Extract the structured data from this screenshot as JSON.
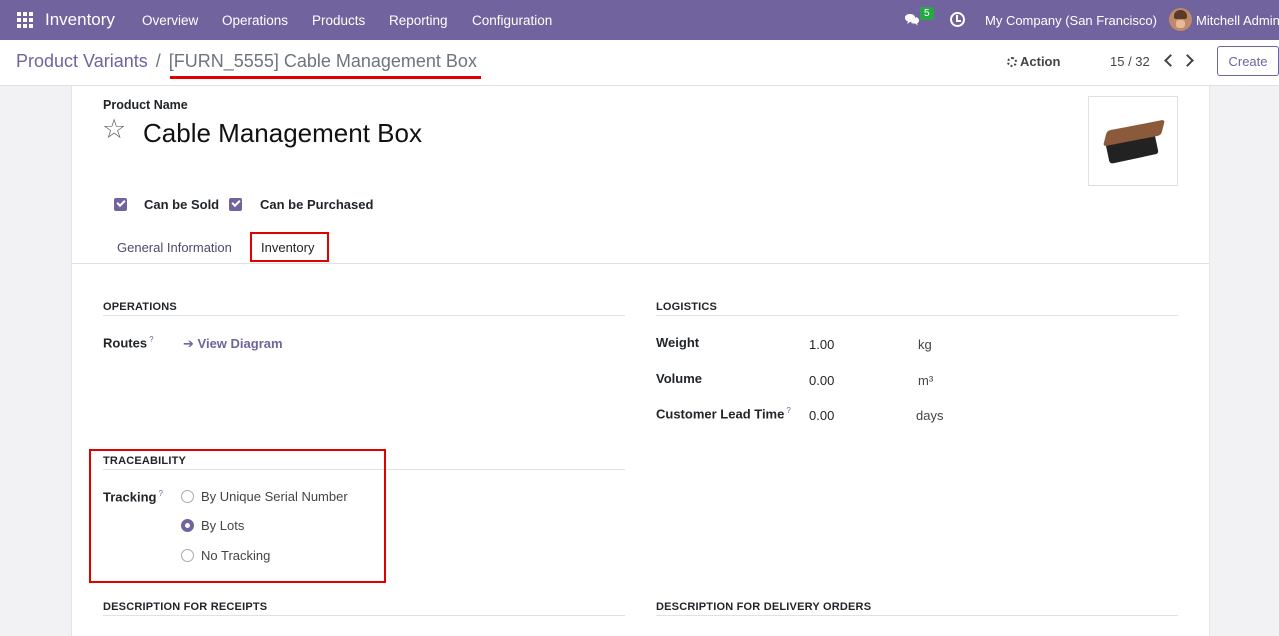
{
  "navbar": {
    "app_title": "Inventory",
    "menu": [
      "Overview",
      "Operations",
      "Products",
      "Reporting",
      "Configuration"
    ],
    "chat_badge": "5",
    "company": "My Company (San Francisco)",
    "user": "Mitchell Admin"
  },
  "control": {
    "breadcrumb_parent": "Product Variants",
    "breadcrumb_sep": "/",
    "breadcrumb_current": "[FURN_5555] Cable Management Box",
    "action_label": "Action",
    "pager": "15 / 32",
    "create_label": "Create"
  },
  "form": {
    "product_name_label": "Product Name",
    "product_name": "Cable Management Box",
    "can_be_sold": "Can be Sold",
    "can_be_purchased": "Can be Purchased",
    "tabs": [
      "General Information",
      "Inventory"
    ],
    "operations": {
      "title": "OPERATIONS",
      "routes_label": "Routes",
      "help_mark": "?",
      "view_diagram": "View Diagram"
    },
    "logistics": {
      "title": "LOGISTICS",
      "weight_label": "Weight",
      "weight_value": "1.00",
      "weight_unit": "kg",
      "volume_label": "Volume",
      "volume_value": "0.00",
      "volume_unit": "m³",
      "lead_time_label": "Customer Lead Time",
      "lead_time_value": "0.00",
      "lead_time_unit": "days"
    },
    "traceability": {
      "title": "TRACEABILITY",
      "tracking_label": "Tracking",
      "options": [
        "By Unique Serial Number",
        "By Lots",
        "No Tracking"
      ],
      "selected": "By Lots"
    },
    "desc_receipts": "DESCRIPTION FOR RECEIPTS",
    "desc_delivery": "DESCRIPTION FOR DELIVERY ORDERS"
  },
  "colors": {
    "brand": "#71639e",
    "highlight": "#e00000",
    "badge": "#28a745"
  }
}
